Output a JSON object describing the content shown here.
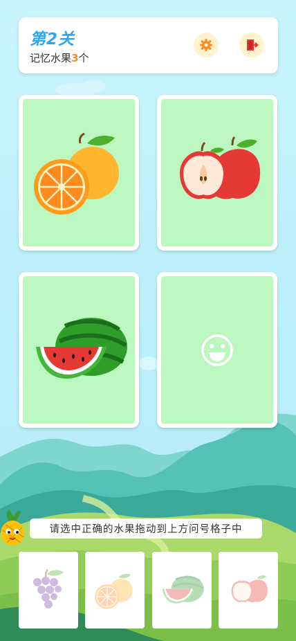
{
  "header": {
    "level_title": "第2关",
    "memory_prefix": "记忆水果",
    "memory_count": "3",
    "memory_suffix": "个"
  },
  "cards": [
    {
      "fruit": "orange-icon",
      "state": "revealed"
    },
    {
      "fruit": "apple-icon",
      "state": "revealed"
    },
    {
      "fruit": "watermelon-icon",
      "state": "revealed"
    },
    {
      "fruit": "smiley-icon",
      "state": "empty"
    }
  ],
  "hint": "请选中正确的水果拖动到上方问号格子中",
  "options": [
    "grape-icon",
    "orange-icon",
    "watermelon-icon",
    "apple-icon"
  ],
  "colors": {
    "accent": "#2da7f2",
    "count": "#ff8a1f",
    "card_fill": "#bcf7bf",
    "button_bg": "#fff2cc"
  }
}
